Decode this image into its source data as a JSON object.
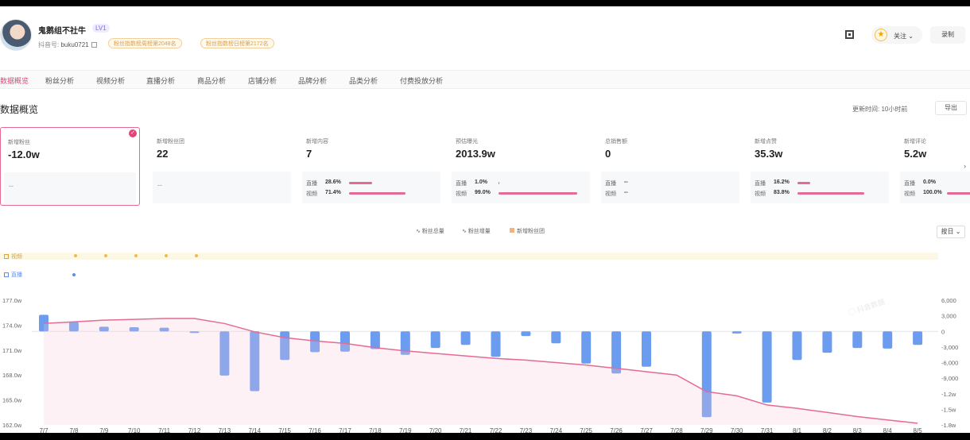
{
  "profile": {
    "name": "鬼鹅组不社牛",
    "level": "LV1",
    "account_label": "抖音号:",
    "account_id": "buku0721",
    "rank_week": "粉丝指数榜周榜第2048名",
    "rank_day": "粉丝指数榜日榜第2172名"
  },
  "header_actions": {
    "follow": "关注",
    "record": "录制"
  },
  "tabs": [
    "数据概览",
    "粉丝分析",
    "视频分析",
    "直播分析",
    "商品分析",
    "店铺分析",
    "品牌分析",
    "品类分析",
    "付费投放分析"
  ],
  "active_tab": 0,
  "section": {
    "title": "数据概览",
    "updated_label": "更新时间:",
    "updated_value": "10小时前",
    "export": "导出"
  },
  "cards": [
    {
      "label": "新增粉丝",
      "value": "-12.0w",
      "selected": true,
      "split": null
    },
    {
      "label": "新增粉丝团",
      "value": "22",
      "selected": false,
      "split": null
    },
    {
      "label": "新增内容",
      "value": "7",
      "selected": false,
      "split": [
        {
          "name": "直播",
          "pct": "28.6%",
          "ratio": 0.286
        },
        {
          "name": "视频",
          "pct": "71.4%",
          "ratio": 0.714
        }
      ]
    },
    {
      "label": "预估曝光",
      "value": "2013.9w",
      "selected": false,
      "split": [
        {
          "name": "直播",
          "pct": "1.0%",
          "ratio": 0.01
        },
        {
          "name": "视频",
          "pct": "99.0%",
          "ratio": 0.99
        }
      ]
    },
    {
      "label": "总销售额",
      "value": "0",
      "selected": false,
      "split": [
        {
          "name": "直播",
          "pct": "--",
          "ratio": 0
        },
        {
          "name": "视频",
          "pct": "--",
          "ratio": 0
        }
      ]
    },
    {
      "label": "新增点赞",
      "value": "35.3w",
      "selected": false,
      "split": [
        {
          "name": "直播",
          "pct": "16.2%",
          "ratio": 0.162
        },
        {
          "name": "视频",
          "pct": "83.8%",
          "ratio": 0.838
        }
      ]
    },
    {
      "label": "新增评论",
      "value": "5.2w",
      "selected": false,
      "split": [
        {
          "name": "直播",
          "pct": "0.0%",
          "ratio": 0
        },
        {
          "name": "视频",
          "pct": "100.0%",
          "ratio": 1.0
        }
      ]
    }
  ],
  "empty_dash": "--",
  "legend": [
    "粉丝总量",
    "粉丝增量",
    "新增粉丝团"
  ],
  "granularity": "按日",
  "tracks": {
    "video": "视频",
    "live": "直播"
  },
  "video_dates": [
    "7/7",
    "7/8",
    "7/9",
    "7/10",
    "7/11"
  ],
  "live_dates": [
    "7/8"
  ],
  "colors": {
    "accent": "#e0457b",
    "bar": "#6b9cf0",
    "line": "#e46b92",
    "video": "#f2b94c",
    "live": "#5b8def"
  },
  "chart_data": {
    "type": "bar",
    "x": [
      "7/7",
      "7/8",
      "7/9",
      "7/10",
      "7/11",
      "7/12",
      "7/13",
      "7/14",
      "7/15",
      "7/16",
      "7/17",
      "7/18",
      "7/19",
      "7/20",
      "7/21",
      "7/22",
      "7/23",
      "7/24",
      "7/25",
      "7/26",
      "7/27",
      "7/28",
      "7/29",
      "7/30",
      "7/31",
      "8/1",
      "8/2",
      "8/3",
      "8/4",
      "8/5"
    ],
    "series": [
      {
        "name": "粉丝总量",
        "type": "line",
        "axis": "left",
        "values": [
          174.2,
          174.4,
          174.6,
          174.7,
          174.8,
          174.8,
          174.2,
          173.2,
          172.5,
          172.1,
          171.8,
          171.3,
          170.9,
          170.6,
          170.3,
          170.0,
          169.8,
          169.5,
          169.2,
          168.8,
          168.4,
          168.0,
          166.0,
          165.5,
          164.4,
          164.0,
          163.5,
          163.0,
          162.6,
          162.2
        ]
      },
      {
        "name": "粉丝增量",
        "type": "bar",
        "axis": "right",
        "values": [
          3200,
          1800,
          900,
          800,
          700,
          -100,
          -8500,
          -11500,
          -5500,
          -4000,
          -3900,
          -3400,
          -4500,
          -3200,
          -2600,
          -4900,
          -900,
          -2300,
          -6200,
          -8100,
          -6800,
          0,
          -16500,
          -400,
          -13700,
          -5500,
          -4100,
          -3200,
          -3300,
          -2600
        ]
      }
    ],
    "ylim_left": [
      162.0,
      177.0
    ],
    "ylim_right": [
      -18000,
      6000
    ],
    "yticks_left": [
      "177.0w",
      "174.0w",
      "171.0w",
      "168.0w",
      "165.0w",
      "162.0w"
    ],
    "yticks_right": [
      "6,000",
      "3,000",
      "0",
      "-3,000",
      "-6,000",
      "-9,000",
      "-1.2w",
      "-1.5w",
      "-1.8w"
    ]
  }
}
